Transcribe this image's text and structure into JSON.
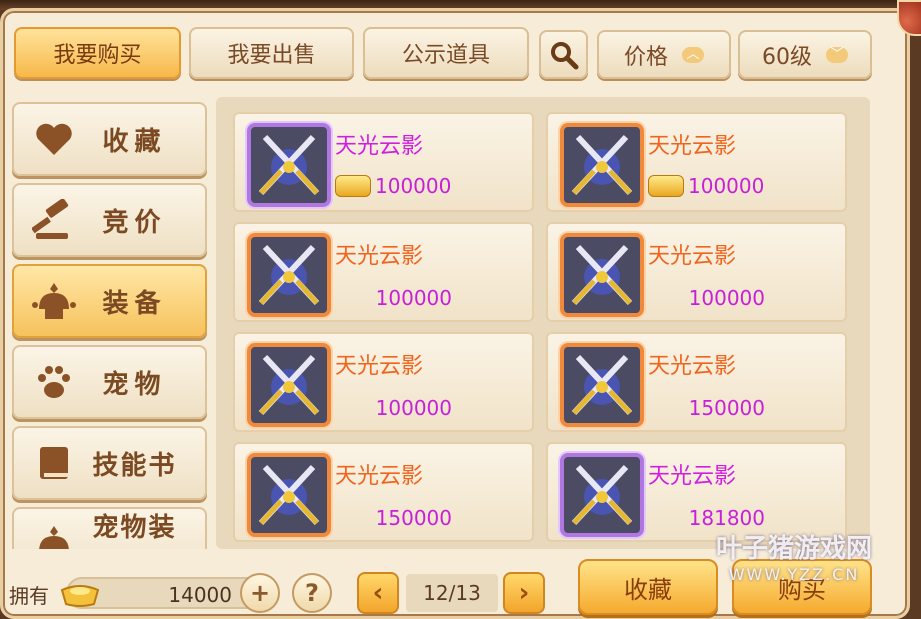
{
  "toolbar": {
    "tabs": [
      {
        "label": "我要购买",
        "active": true
      },
      {
        "label": "我要出售",
        "active": false
      },
      {
        "label": "公示道具",
        "active": false
      }
    ],
    "search_icon": "search-icon",
    "sort_label": "价格",
    "level_label": "60级"
  },
  "sidebar": {
    "items": [
      {
        "label": "收藏",
        "icon": "heart-icon",
        "active": false
      },
      {
        "label": "竞价",
        "icon": "gavel-icon",
        "active": false
      },
      {
        "label": "装备",
        "icon": "helmet-icon",
        "active": true
      },
      {
        "label": "宠物",
        "icon": "paw-icon",
        "active": false
      },
      {
        "label": "技能书",
        "icon": "book-icon",
        "active": false
      },
      {
        "label": "宠物装备",
        "icon": "pet-equipment-icon",
        "active": false
      }
    ]
  },
  "items": [
    {
      "name": "天光云影",
      "price": "100000",
      "quality": "purple",
      "show_ingot": true
    },
    {
      "name": "天光云影",
      "price": "100000",
      "quality": "orange",
      "show_ingot": true
    },
    {
      "name": "天光云影",
      "price": "100000",
      "quality": "orange",
      "show_ingot": false
    },
    {
      "name": "天光云影",
      "price": "100000",
      "quality": "orange",
      "show_ingot": false
    },
    {
      "name": "天光云影",
      "price": "100000",
      "quality": "orange",
      "show_ingot": false
    },
    {
      "name": "天光云影",
      "price": "150000",
      "quality": "orange",
      "show_ingot": false
    },
    {
      "name": "天光云影",
      "price": "150000",
      "quality": "orange",
      "show_ingot": false
    },
    {
      "name": "天光云影",
      "price": "181800",
      "quality": "purple",
      "show_ingot": false
    }
  ],
  "footer": {
    "own_label": "拥有",
    "money": "14000",
    "add_icon": "+",
    "help_icon": "?",
    "prev_icon": "‹",
    "next_icon": "›",
    "page": "12/13",
    "favorite_label": "收藏",
    "buy_label": "购买"
  },
  "watermark": {
    "main": "叶子猪游戏网",
    "sub": "WWW.YZZ.CN"
  }
}
